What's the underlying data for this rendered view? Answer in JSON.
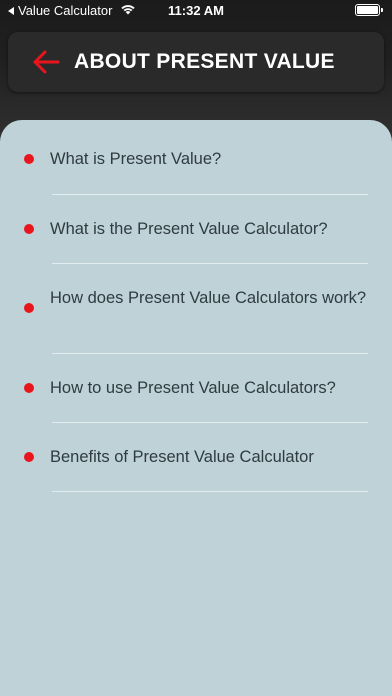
{
  "status_bar": {
    "back_app": "Value Calculator",
    "time": "11:32 AM"
  },
  "header": {
    "title": "ABOUT PRESENT VALUE",
    "accent_color": "#e8151d"
  },
  "panel": {
    "background": "#bfd2d8"
  },
  "items": [
    {
      "label": "What is Present Value?"
    },
    {
      "label": "What is the Present Value Calculator?"
    },
    {
      "label": "How does Present Value Calculators work?"
    },
    {
      "label": "How to use Present Value Calculators?"
    },
    {
      "label": "Benefits of Present Value Calculator"
    }
  ]
}
